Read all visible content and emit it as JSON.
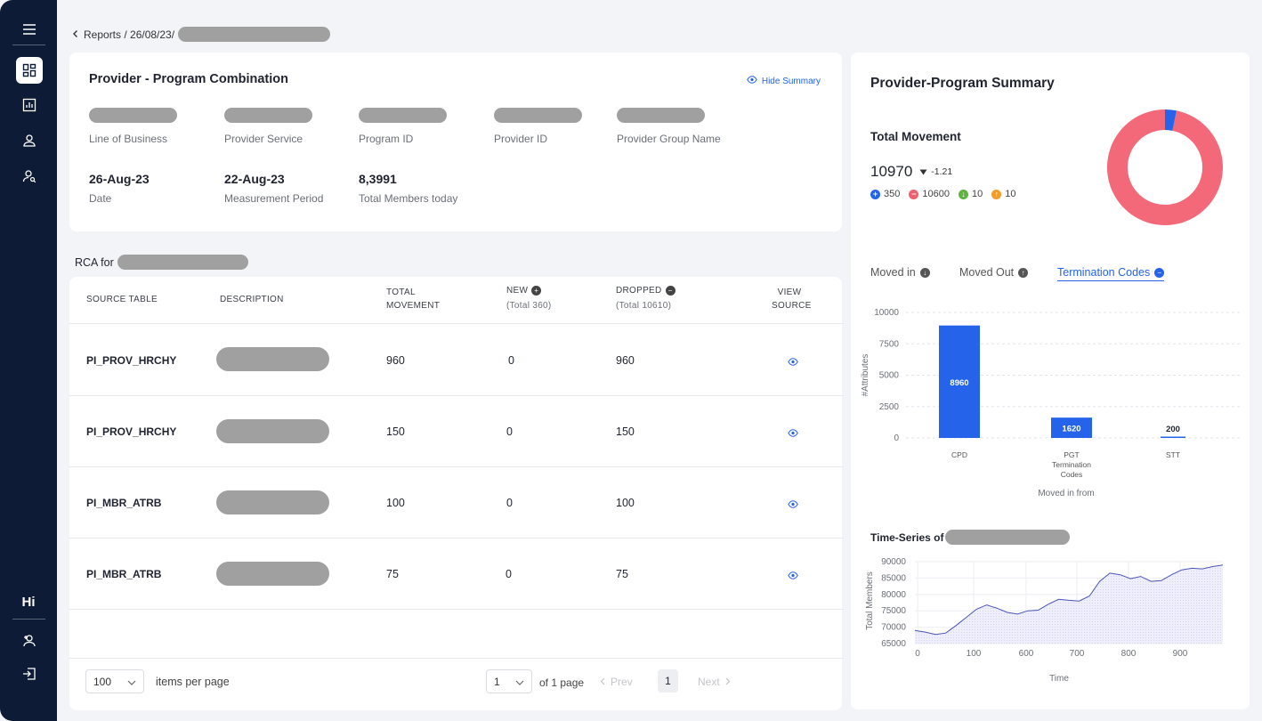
{
  "breadcrumb": {
    "text": "Reports / 26/08/23/"
  },
  "summary_card": {
    "title": "Provider - Program Combination",
    "hide_label": "Hide Summary",
    "fields": [
      {
        "label": "Line of Business"
      },
      {
        "label": "Provider Service"
      },
      {
        "label": "Program ID"
      },
      {
        "label": "Provider ID"
      },
      {
        "label": "Provider Group Name"
      }
    ],
    "stats": [
      {
        "value": "26-Aug-23",
        "label": "Date"
      },
      {
        "value": "22-Aug-23",
        "label": "Measurement Period"
      },
      {
        "value": "8,3991",
        "label": "Total Members today"
      }
    ]
  },
  "rca": {
    "title": "RCA for",
    "headers": {
      "source": "SOURCE TABLE",
      "desc": "DESCRIPTION",
      "total1": "TOTAL",
      "total2": "MOVEMENT",
      "new": "NEW",
      "new_sub": "(Total 360)",
      "dropped": "DROPPED",
      "dropped_sub": "(Total 10610)",
      "view1": "VIEW",
      "view2": "SOURCE"
    },
    "rows": [
      {
        "source": "PI_PROV_HRCHY",
        "total": "960",
        "new": "0",
        "dropped": "960"
      },
      {
        "source": "PI_PROV_HRCHY",
        "total": "150",
        "new": "0",
        "dropped": "150"
      },
      {
        "source": "PI_MBR_ATRB",
        "total": "100",
        "new": "0",
        "dropped": "100"
      },
      {
        "source": "PI_MBR_ATRB",
        "total": "75",
        "new": "0",
        "dropped": "75"
      }
    ]
  },
  "pagination": {
    "per_page": "100",
    "per_page_label": "items per page",
    "page": "1",
    "of_label": "of 1 page",
    "prev": "Prev",
    "current": "1",
    "next": "Next"
  },
  "right_panel": {
    "title": "Provider-Program Summary",
    "movement_title": "Total Movement",
    "movement_value": "10970",
    "movement_delta": "-1.21",
    "legend": [
      {
        "value": "350",
        "color": "#2563eb",
        "symbol": "+"
      },
      {
        "value": "10600",
        "color": "#f0606e",
        "symbol": "−"
      },
      {
        "value": "10",
        "color": "#5fb340",
        "symbol": "↓"
      },
      {
        "value": "10",
        "color": "#f39c2a",
        "symbol": "↑"
      }
    ],
    "tabs": [
      "Moved in",
      "Moved Out",
      "Termination Codes"
    ],
    "colors": {
      "accent": "#2563eb",
      "donut_main": "#f3697a",
      "donut_minor": "#2563eb"
    }
  },
  "chart_data": [
    {
      "type": "pie",
      "donut": true,
      "values": [
        10600,
        350
      ],
      "colors": [
        "#f3697a",
        "#2563eb"
      ]
    },
    {
      "type": "bar",
      "categories": [
        "CPD",
        "PGT Termination Codes",
        "STT"
      ],
      "category_lines": [
        [
          "CPD"
        ],
        [
          "PGT",
          "Termination",
          "Codes"
        ],
        [
          "STT"
        ]
      ],
      "values": [
        8960,
        1620,
        200
      ],
      "ylabel": "#Attributes",
      "xlabel": "Moved in from",
      "ylim": [
        0,
        10000
      ],
      "yticks": [
        "10000",
        "7500",
        "5000",
        "2500",
        "0"
      ],
      "color": "#2563eb"
    },
    {
      "type": "area",
      "title": "Time-Series of",
      "ylabel": "Total Members",
      "xlabel": "Time",
      "xticks": [
        "0",
        "100",
        "600",
        "700",
        "800",
        "900"
      ],
      "yticks": [
        "90000",
        "85000",
        "80000",
        "75000",
        "70000",
        "65000"
      ],
      "ylim": [
        65000,
        90000
      ],
      "x": [
        0,
        1,
        2,
        3,
        4,
        5,
        6,
        7,
        8,
        9,
        10,
        11,
        12,
        13,
        14,
        15,
        16,
        17,
        18,
        19,
        20,
        21,
        22,
        23,
        24,
        25,
        26,
        27,
        28,
        29,
        30
      ],
      "values": [
        69000,
        68500,
        67800,
        68200,
        70500,
        73000,
        75500,
        76800,
        75800,
        74500,
        74000,
        75000,
        75200,
        77000,
        78500,
        78200,
        78000,
        79500,
        84000,
        86500,
        86000,
        84800,
        85500,
        84000,
        84200,
        86000,
        87500,
        88000,
        87800,
        88500,
        89000
      ],
      "color": "#4a53b8"
    }
  ]
}
